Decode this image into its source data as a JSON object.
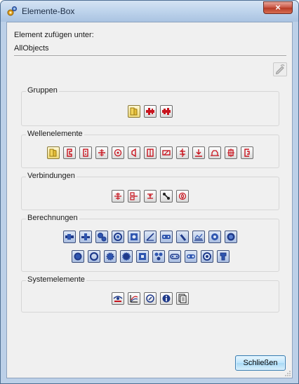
{
  "window": {
    "title": "Elemente-Box",
    "close_glyph": "×"
  },
  "header": {
    "caption": "Element zufügen unter:",
    "path": "AllObjects"
  },
  "toolbar": {
    "edit_icon": "pencil-icon"
  },
  "groups": [
    {
      "label": "Gruppen"
    },
    {
      "label": "Wellenelemente"
    },
    {
      "label": "Verbindungen"
    },
    {
      "label": "Berechnungen"
    },
    {
      "label": "Systemelemente"
    }
  ],
  "buttons": {
    "close_label": "Schließen"
  },
  "colors": {
    "red_icon": "#c8141e",
    "blue_icon": "#1f3a8a",
    "folder": "#e8c84a",
    "accent": "#3c7fb1"
  }
}
